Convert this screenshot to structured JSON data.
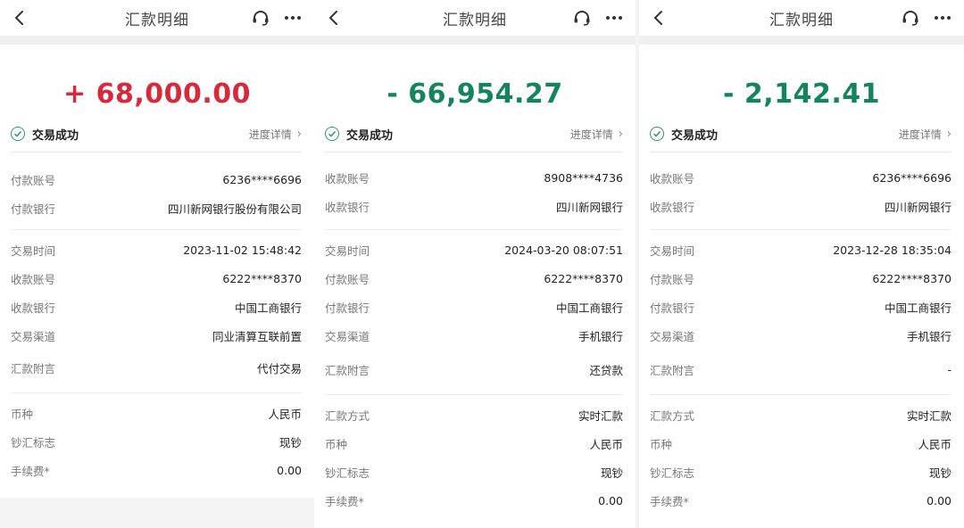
{
  "panels": [
    {
      "nav_title": "汇款明细",
      "amount": "+ 68,000.00",
      "amount_color": "#d7283c",
      "status": "交易成功",
      "progress_link": "进度详情",
      "sections": [
        [
          {
            "label": "付款账号",
            "value": "6236****6696"
          },
          {
            "label": "付款银行",
            "value": "四川新网银行股份有限公司"
          }
        ],
        [
          {
            "label": "交易时间",
            "value": "2023-11-02 15:48:42"
          },
          {
            "label": "收款账号",
            "value": "6222****8370"
          },
          {
            "label": "收款银行",
            "value": "中国工商银行"
          },
          {
            "label": "交易渠道",
            "value": "同业清算互联前置"
          },
          {
            "label": "汇款附言",
            "value": "代付交易"
          }
        ],
        [
          {
            "label": "币种",
            "value": "人民币"
          },
          {
            "label": "钞汇标志",
            "value": "现钞"
          },
          {
            "label": "手续费*",
            "value": "0.00"
          }
        ]
      ]
    },
    {
      "nav_title": "汇款明细",
      "amount": "- 66,954.27",
      "amount_color": "#14855a",
      "status": "交易成功",
      "progress_link": "进度详情",
      "sections": [
        [
          {
            "label": "收款账号",
            "value": "8908****4736"
          },
          {
            "label": "收款银行",
            "value": "四川新网银行"
          }
        ],
        [
          {
            "label": "交易时间",
            "value": "2024-03-20 08:07:51"
          },
          {
            "label": "付款账号",
            "value": "6222****8370"
          },
          {
            "label": "付款银行",
            "value": "中国工商银行"
          },
          {
            "label": "交易渠道",
            "value": "手机银行"
          },
          {
            "label": "汇款附言",
            "value": "还贷款"
          }
        ],
        [
          {
            "label": "汇款方式",
            "value": "实时汇款"
          },
          {
            "label": "币种",
            "value": "人民币"
          },
          {
            "label": "钞汇标志",
            "value": "现钞"
          },
          {
            "label": "手续费*",
            "value": "0.00"
          }
        ]
      ]
    },
    {
      "nav_title": "汇款明细",
      "amount": "- 2,142.41",
      "amount_color": "#14855a",
      "status": "交易成功",
      "progress_link": "进度详情",
      "sections": [
        [
          {
            "label": "收款账号",
            "value": "6236****6696"
          },
          {
            "label": "收款银行",
            "value": "四川新网银行"
          }
        ],
        [
          {
            "label": "交易时间",
            "value": "2023-12-28 18:35:04"
          },
          {
            "label": "付款账号",
            "value": "6222****8370"
          },
          {
            "label": "付款银行",
            "value": "中国工商银行"
          },
          {
            "label": "交易渠道",
            "value": "手机银行"
          },
          {
            "label": "汇款附言",
            "value": "-"
          }
        ],
        [
          {
            "label": "汇款方式",
            "value": "实时汇款"
          },
          {
            "label": "币种",
            "value": "人民币"
          },
          {
            "label": "钞汇标志",
            "value": "现钞"
          },
          {
            "label": "手续费*",
            "value": "0.00"
          }
        ]
      ]
    }
  ]
}
